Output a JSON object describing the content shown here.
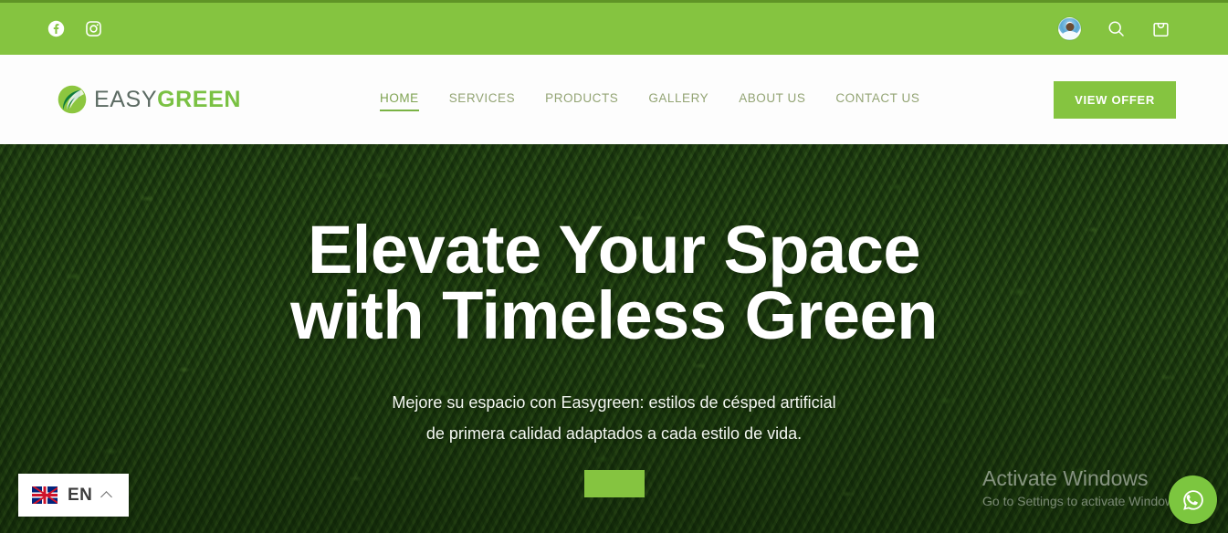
{
  "topbar": {
    "social": [
      {
        "name": "facebook-icon",
        "label": "Facebook"
      },
      {
        "name": "instagram-icon",
        "label": "Instagram"
      }
    ],
    "avatar_label": "User account",
    "search_label": "Search",
    "cart_label": "Cart",
    "background_color": "#85c440",
    "accent_strip_color": "#5f9426"
  },
  "header": {
    "logo": {
      "easy": "EASY",
      "green": "GREEN",
      "easy_color": "#5c6b63",
      "green_color": "#7ac143"
    },
    "nav": [
      {
        "label": "HOME",
        "active": true
      },
      {
        "label": "SERVICES",
        "active": false
      },
      {
        "label": "PRODUCTS",
        "active": false
      },
      {
        "label": "GALLERY",
        "active": false
      },
      {
        "label": "ABOUT US",
        "active": false
      },
      {
        "label": "CONTACT US",
        "active": false
      }
    ],
    "cta_label": "VIEW OFFER",
    "cta_color": "#85c440"
  },
  "hero": {
    "title_line1": "Elevate Your Space",
    "title_line2": "with Timeless Green",
    "subtitle_line1": "Mejore su espacio con Easygreen: estilos de césped artificial",
    "subtitle_line2": "de primera calidad adaptados a cada estilo de vida.",
    "cta_label": "",
    "cta_color": "#85c440"
  },
  "language_selector": {
    "flag": "uk-flag-icon",
    "code": "EN",
    "chevron": "chevron-up-icon"
  },
  "windows_watermark": {
    "line1": "Activate Windows",
    "line2": "Go to Settings to activate Windows."
  },
  "whatsapp": {
    "label": "WhatsApp chat",
    "color": "#7cc63f"
  }
}
